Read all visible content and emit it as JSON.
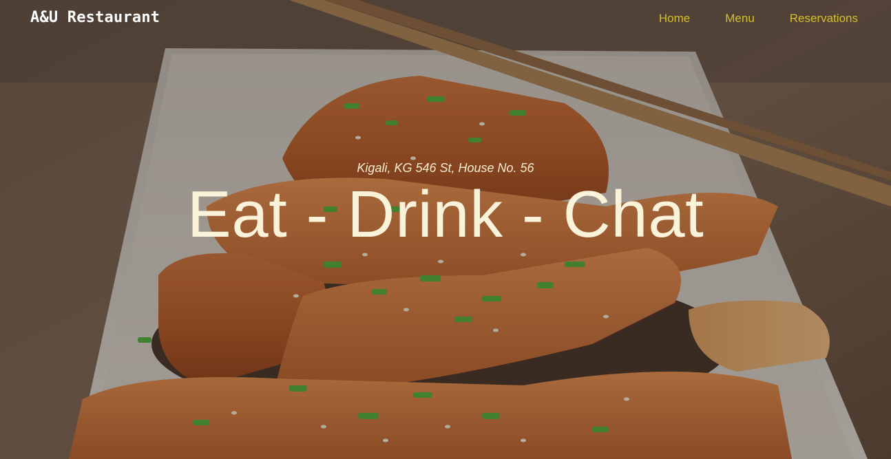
{
  "navbar": {
    "brand": "A&U Restaurant",
    "links": [
      {
        "label": "Home"
      },
      {
        "label": "Menu"
      },
      {
        "label": "Reservations"
      }
    ],
    "link_color": "#d4bf2e"
  },
  "hero": {
    "address": "Kigali, KG 546 St, House No. 56",
    "headline": "Eat - Drink - Chat",
    "image": "salmon-dish-photo",
    "text_color": "#fbf2da"
  }
}
